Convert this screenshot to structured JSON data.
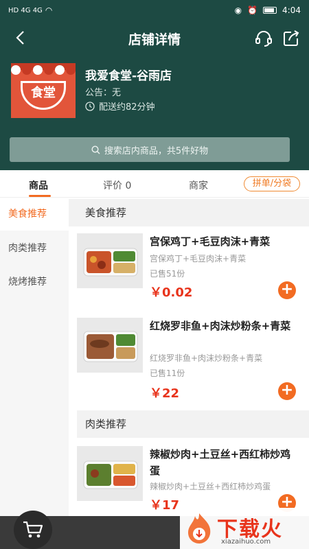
{
  "status_bar": {
    "left": "HD 4G 4G",
    "time": "4:04"
  },
  "nav": {
    "title": "店铺详情"
  },
  "shop": {
    "name": "我爱食堂-谷雨店",
    "notice": "公告：无",
    "delivery": "配送约82分钟",
    "logo_text": "食堂"
  },
  "search": {
    "placeholder": "搜索店内商品，共5件好物"
  },
  "tabs": [
    {
      "label": "商品",
      "active": true
    },
    {
      "label": "评价 0",
      "active": false
    },
    {
      "label": "商家",
      "active": false
    }
  ],
  "pindan_label": "拼单/分袋",
  "sidebar": {
    "items": [
      {
        "label": "美食推荐",
        "active": true
      },
      {
        "label": "肉类推荐",
        "active": false
      },
      {
        "label": "烧烤推荐",
        "active": false
      }
    ]
  },
  "categories": [
    {
      "title": "美食推荐",
      "items": [
        {
          "name": "宫保鸡丁+毛豆肉沫+青菜",
          "desc": "宫保鸡丁+毛豆肉沫+青菜",
          "sold": "已售51份",
          "price": "￥0.02"
        },
        {
          "name": "红烧罗非鱼+肉沫炒粉条+青菜",
          "desc": "红烧罗非鱼+肉沫炒粉条+青菜",
          "sold": "已售11份",
          "price": "￥22"
        }
      ]
    },
    {
      "title": "肉类推荐",
      "items": [
        {
          "name": "辣椒炒肉+土豆丝+西红柿炒鸡蛋",
          "desc": "辣椒炒肉+土豆丝+西红柿炒鸡蛋",
          "price": "￥17"
        }
      ]
    }
  ],
  "add_label": "+",
  "watermark": {
    "text": "下载火",
    "url": "xiazaihuo.com"
  },
  "colors": {
    "header_bg": "#1d4a43",
    "accent": "#f26b22",
    "price": "#e8341c"
  }
}
